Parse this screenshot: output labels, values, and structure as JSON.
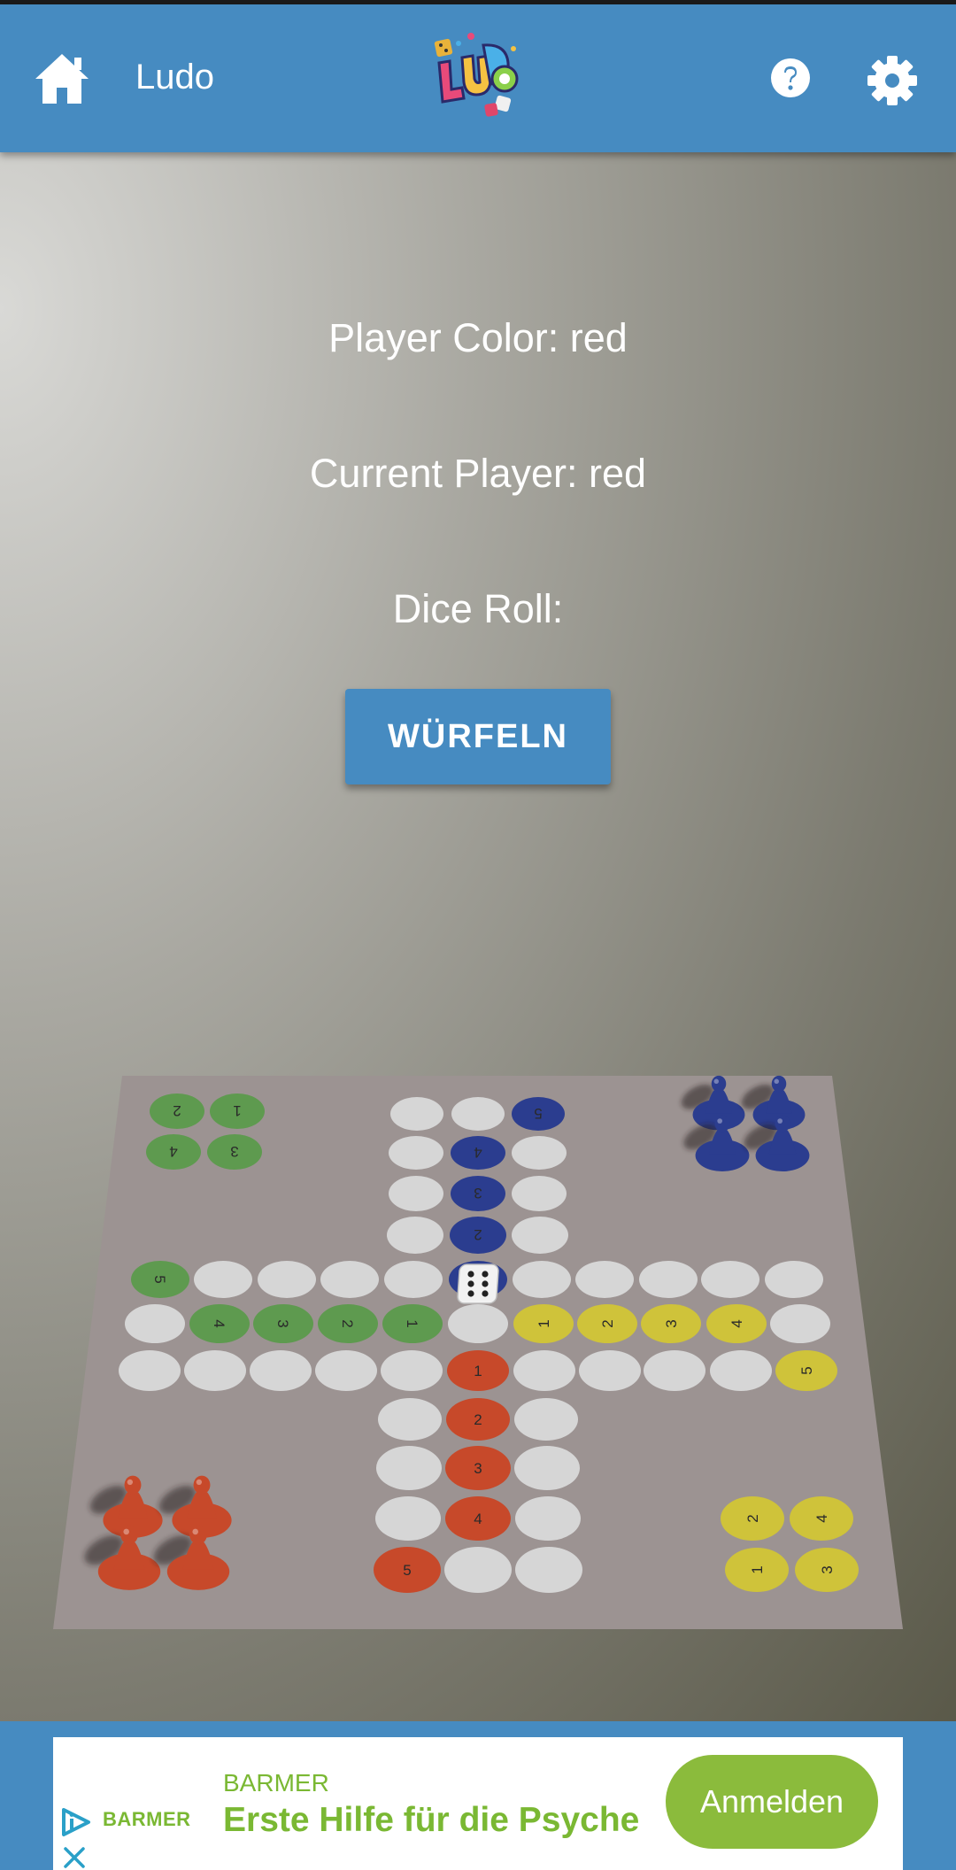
{
  "app_bar": {
    "title": "Ludo",
    "home_icon": "home-icon",
    "help_icon": "help-icon",
    "settings_icon": "gear-icon",
    "background": "#468bc1"
  },
  "game": {
    "player_color_text": "Player Color: red",
    "current_player_text": "Current Player: red",
    "dice_roll_text": "Dice Roll:",
    "roll_button_label": "WÜRFELN",
    "dice_value": 6
  },
  "board": {
    "colors": {
      "red": "#c7492a",
      "green": "#5e9a4f",
      "blue": "#2b3d8f",
      "yellow": "#cfc33a",
      "empty": "#d6d6d6",
      "board": "#9c9392"
    },
    "home_labels": {
      "green": [
        "2",
        "1",
        "4",
        "3"
      ],
      "blue_path": [
        "5",
        "4",
        "3",
        "2"
      ],
      "green_path": [
        "5",
        "4",
        "3",
        "2",
        "1"
      ],
      "yellow_path": [
        "1",
        "2",
        "3",
        "4",
        "5"
      ],
      "red_path": [
        "1",
        "2",
        "3",
        "4",
        "5"
      ],
      "yellow_home": [
        "2",
        "4",
        "1",
        "3"
      ]
    }
  },
  "ad": {
    "logo_text": "BARMER",
    "brand": "BARMER",
    "headline": "Erste Hilfe für die Psyche",
    "cta_label": "Anmelden"
  }
}
